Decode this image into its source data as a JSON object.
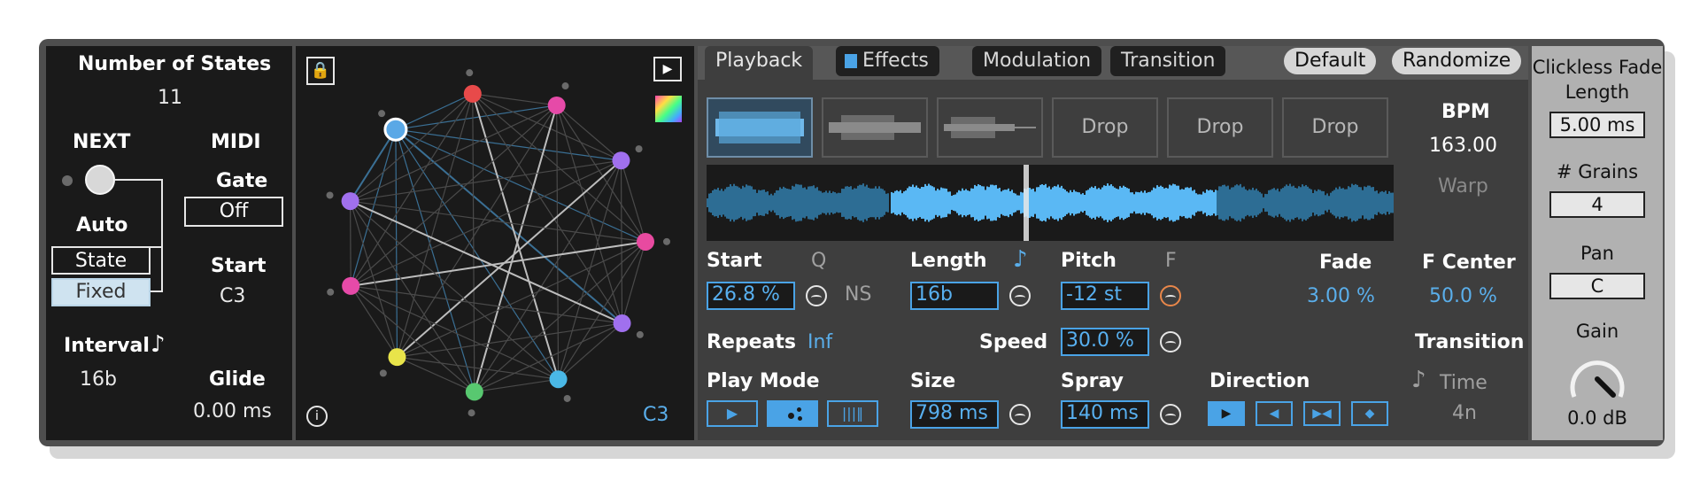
{
  "left": {
    "num_states_label": "Number of States",
    "num_states_value": "11",
    "next_label": "NEXT",
    "midi_label": "MIDI",
    "gate_label": "Gate",
    "gate_value": "Off",
    "auto_label": "Auto",
    "state_button": "State",
    "fixed_button": "Fixed",
    "start_label": "Start",
    "start_value": "C3",
    "interval_label": "Interval",
    "interval_value": "16b",
    "glide_label": "Glide",
    "glide_value": "0.00 ms"
  },
  "graph": {
    "note": "C3"
  },
  "tabs": {
    "playback": "Playback",
    "effects": "Effects",
    "modulation": "Modulation",
    "transition": "Transition",
    "default": "Default",
    "randomize": "Randomize"
  },
  "slots": [
    "Drop",
    "Drop",
    "Drop"
  ],
  "playback": {
    "bpm_label": "BPM",
    "bpm_value": "163.00",
    "warp_label": "Warp",
    "start_label": "Start",
    "q_label": "Q",
    "start_value": "26.8 %",
    "ns_label": "NS",
    "length_label": "Length",
    "length_value": "16b",
    "pitch_label": "Pitch",
    "f_label": "F",
    "pitch_value": "-12 st",
    "fade_label": "Fade",
    "fade_value": "3.00 %",
    "fcenter_label": "F Center",
    "fcenter_value": "50.0 %",
    "repeats_label": "Repeats",
    "repeats_value": "Inf",
    "speed_label": "Speed",
    "speed_value": "30.0 %",
    "transition_label": "Transition",
    "playmode_label": "Play Mode",
    "size_label": "Size",
    "size_value": "798 ms",
    "spray_label": "Spray",
    "spray_value": "140 ms",
    "direction_label": "Direction",
    "time_label": "Time",
    "time_value": "4n"
  },
  "right": {
    "clickless_label": "Clickless Fade Length",
    "clickless_value": "5.00 ms",
    "grains_label": "# Grains",
    "grains_value": "4",
    "pan_label": "Pan",
    "pan_value": "C",
    "gain_label": "Gain",
    "gain_value": "0.0 dB"
  },
  "colors": {
    "accent_blue": "#4aa3e6",
    "panel_dark": "#1a1a1a",
    "panel_gray": "#3e3e3e"
  }
}
